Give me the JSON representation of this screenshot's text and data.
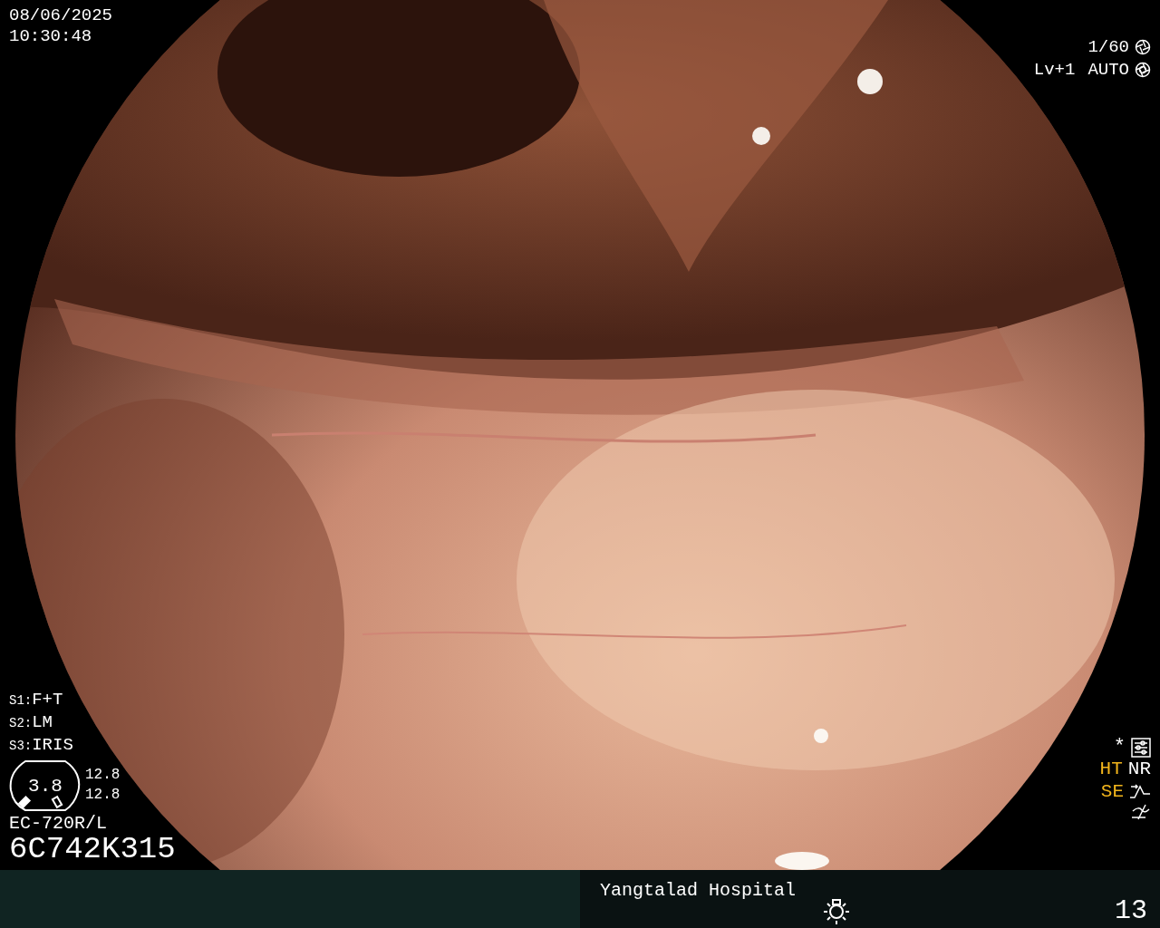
{
  "datetime": {
    "date": "08/06/2025",
    "time": "10:30:48"
  },
  "exposure": {
    "shutter": "1/60",
    "level": "Lv+1",
    "iris_mode": "AUTO"
  },
  "scope_settings": [
    {
      "key": "S1:",
      "value": "F+T"
    },
    {
      "key": "S2:",
      "value": "LM"
    },
    {
      "key": "S3:",
      "value": "IRIS"
    }
  ],
  "zoom_gauge": {
    "value": "3.8",
    "readings": [
      "12.8",
      "12.8"
    ]
  },
  "scope": {
    "model": "EC-720R/L",
    "serial": "6C742K315"
  },
  "enhancements": {
    "marker": "*",
    "rows": [
      [
        {
          "label": "HT",
          "color": "#f2b51c"
        },
        {
          "label": "NR",
          "color": "#ffffff"
        }
      ],
      [
        {
          "label": "SE",
          "color": "#f2b51c"
        }
      ]
    ]
  },
  "footer": {
    "hospital": "Yangtalad Hospital",
    "frame_number": "13"
  }
}
